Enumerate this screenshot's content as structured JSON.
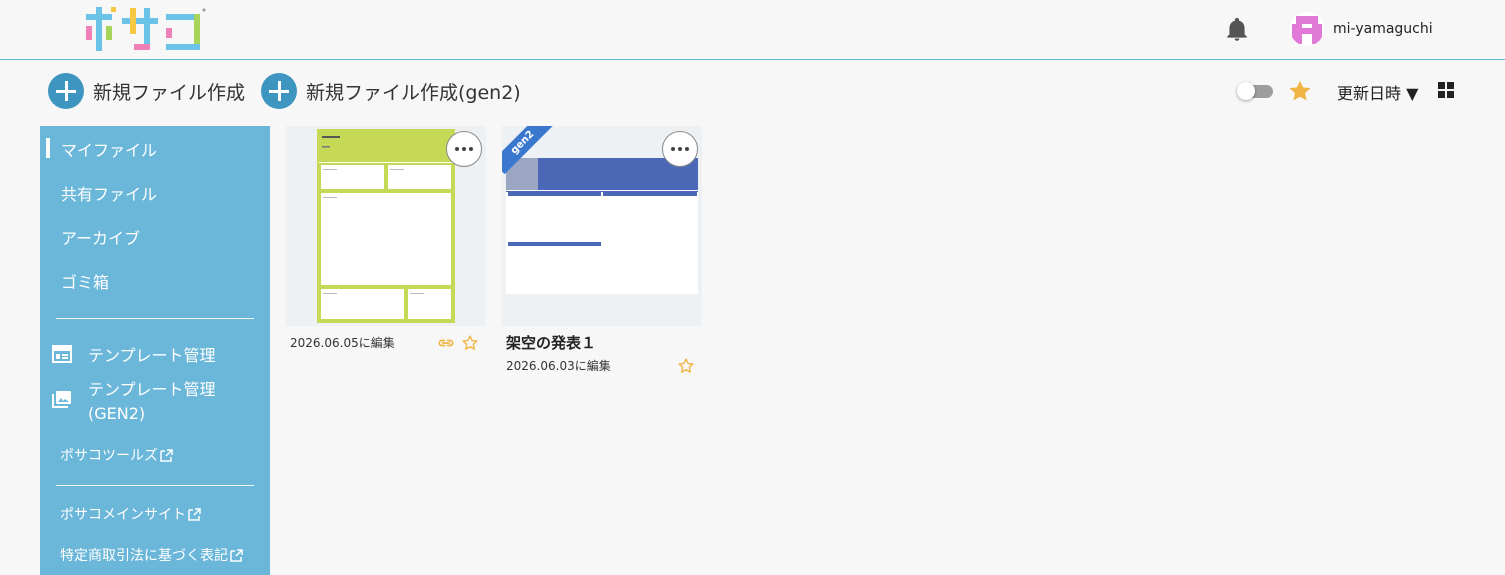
{
  "header": {
    "logo_text": "ポサコ",
    "username": "mi-yamaguchi"
  },
  "toolbar": {
    "new_file_label": "新規ファイル作成",
    "new_file_gen2_label": "新規ファイル作成(gen2)",
    "sort_label": "更新日時 ▼"
  },
  "sidebar": {
    "items": [
      {
        "label": "マイファイル",
        "active": true
      },
      {
        "label": "共有ファイル"
      },
      {
        "label": "アーカイブ"
      },
      {
        "label": "ゴミ箱"
      }
    ],
    "template_items": [
      {
        "label": "テンプレート管理",
        "icon": "template-icon"
      },
      {
        "label": "テンプレート管理\n(GEN2)",
        "icon": "image-gallery-icon"
      }
    ],
    "external_links": [
      {
        "label": "ポサコツールズ"
      },
      {
        "label": "ポサコメインサイト"
      },
      {
        "label": "特定商取引法に基づく表記"
      }
    ]
  },
  "files": [
    {
      "title": "",
      "date": "2026.06.05に編集",
      "gen2": false,
      "has_link": true
    },
    {
      "title": "架空の発表１",
      "date": "2026.06.03に編集",
      "gen2": true,
      "badge": "gen2",
      "has_link": false
    }
  ],
  "colors": {
    "accent_blue": "#3d95c0",
    "sidebar_bg": "#6bb7da",
    "star": "#f0b545",
    "poster_green": "#c5d957",
    "poster_blue": "#4a68b5",
    "gen2_badge": "#3a78cf"
  }
}
